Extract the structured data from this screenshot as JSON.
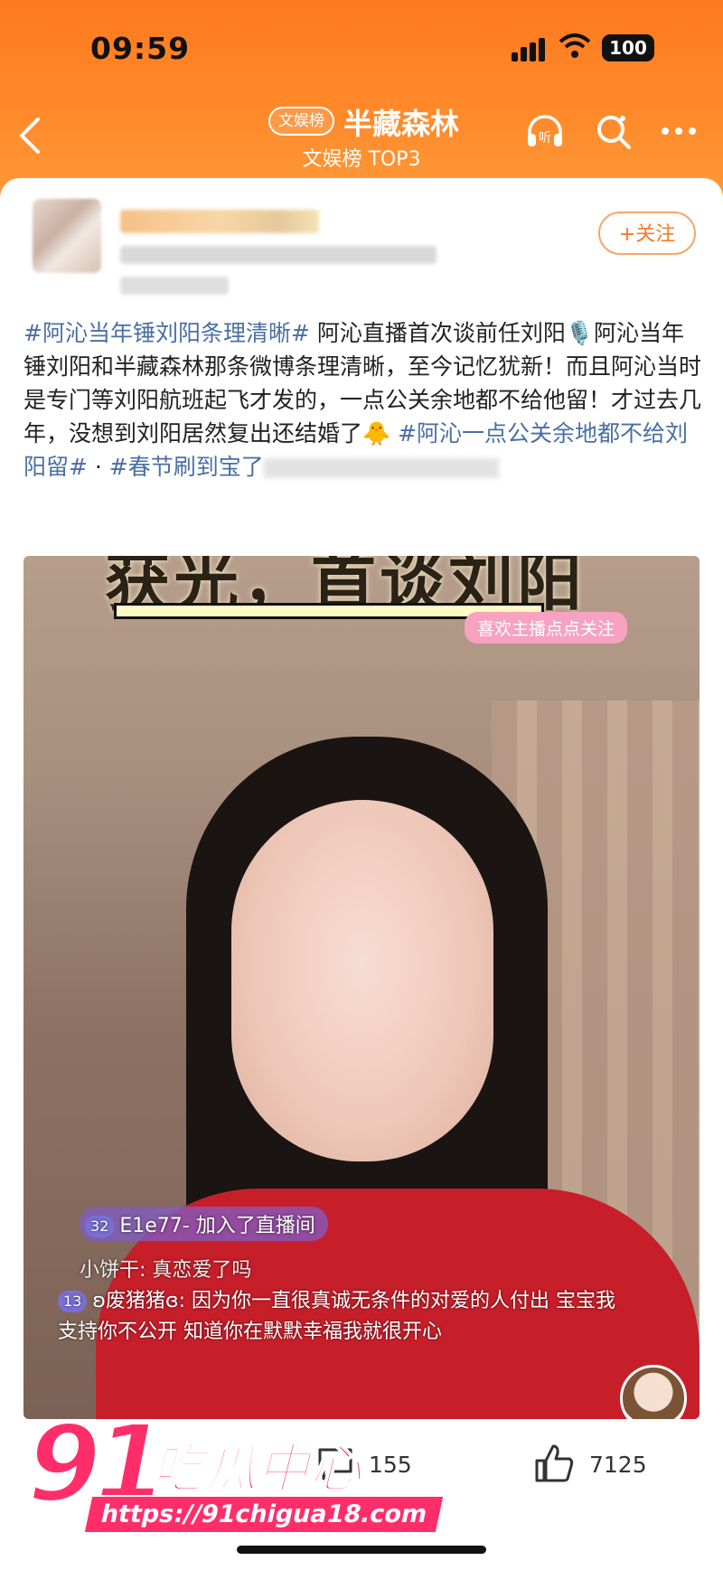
{
  "status_bar": {
    "time": "09:59",
    "battery": "100"
  },
  "header": {
    "badge": "文娱榜",
    "title": "半藏森林",
    "subtitle": "文娱榜 TOP3"
  },
  "post": {
    "follow_label": "+关注",
    "tag1": "#阿沁当年锤刘阳条理清晰#",
    "text1": " 阿沁直播首次谈前任刘阳🎙️阿沁当年锤刘阳和半藏森林那条微博条理清晰，至今记忆犹新！而且阿沁当时是专门等刘阳航班起飞才发的，一点公关余地都不给他留！才过去几年，没想到刘阳居然复出还结婚了🐥 ",
    "tag2": "#阿沁一点公关余地都不给刘阳留#",
    "sep": " · ",
    "tag3": "#春节刷到宝了"
  },
  "video": {
    "caption": "获光，首谈刘阳",
    "tip": "喜欢主播点点关注",
    "chat": [
      {
        "level": "32",
        "text": "E1e77- 加入了直播间"
      },
      {
        "level": "",
        "text": "小饼干: 真恋爱了吗"
      },
      {
        "level": "13",
        "text": "ʚ废猪猪ɞ: 因为你一直很真诚无条件的对爱的人付出 宝宝我支持你不公开 知道你在默默幸福我就很开心"
      }
    ]
  },
  "actions": {
    "comments": "155",
    "likes": "7125"
  },
  "watermark": {
    "number": "91",
    "name": "吃瓜中心",
    "url": "https://91chigua18.com"
  }
}
